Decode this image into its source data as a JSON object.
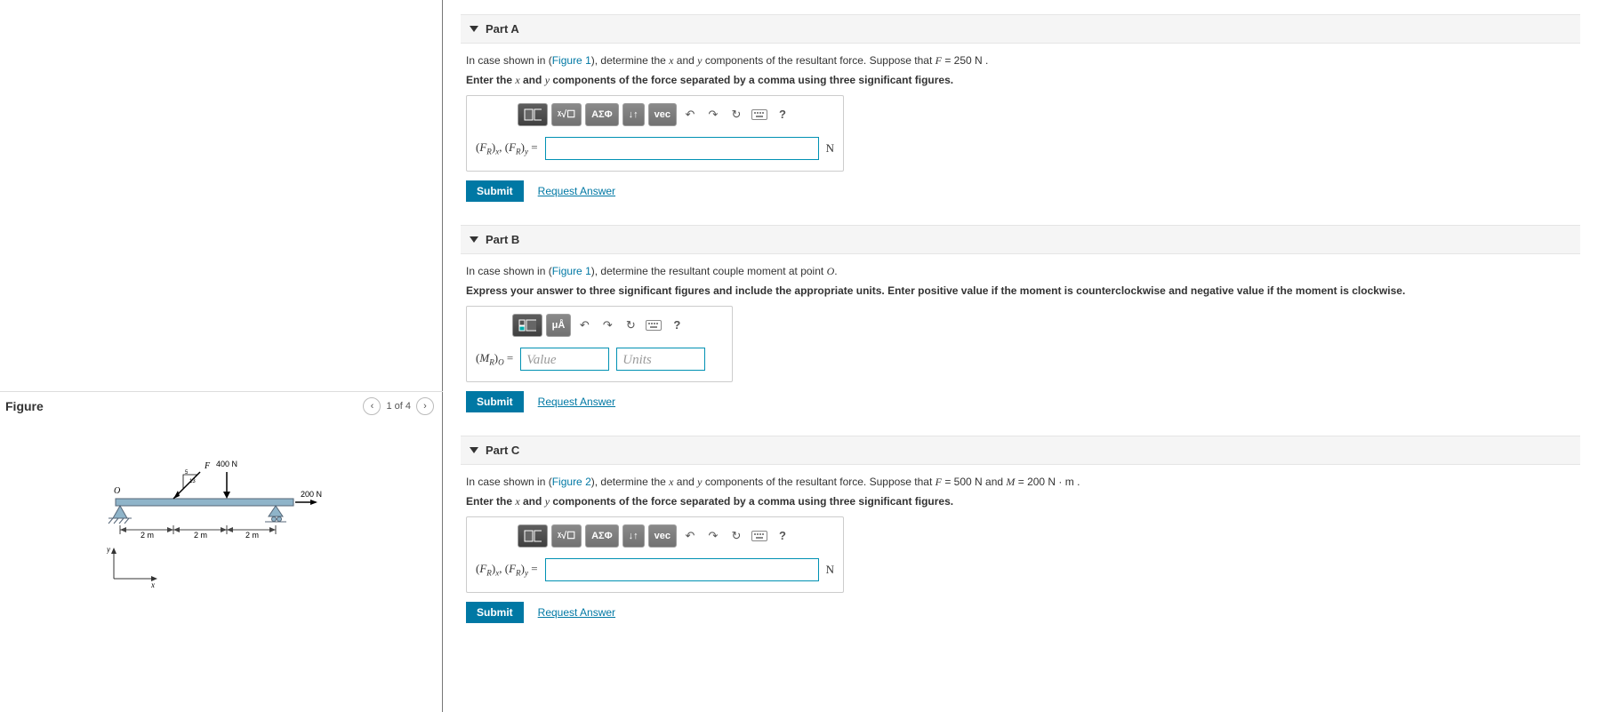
{
  "figure": {
    "title": "Figure",
    "pager": "1 of 4",
    "labels": {
      "F": "F",
      "force400": "400 N",
      "force200": "200 N",
      "d1": "2 m",
      "d2": "2 m",
      "d3": "2 m",
      "axisY": "y",
      "axisX": "x",
      "O": "O",
      "angle": "5",
      "angle2": "13"
    }
  },
  "partA": {
    "title": "Part A",
    "text1a": "In case shown in (",
    "figLink": "Figure 1",
    "text1b": "), determine the ",
    "var_x": "x",
    "text1c": " and ",
    "var_y": "y",
    "text1d": " components of the resultant force. Suppose that ",
    "var_F": "F",
    "text1e": " = 250  N .",
    "instr1": "Enter the ",
    "instr2": " and ",
    "instr3": " components of the force separated by a comma using three significant figures.",
    "tool_sqrt": "ᵡ√☐",
    "tool_greek": "ΑΣΦ",
    "tool_arrows": "↓↑",
    "tool_vec": "vec",
    "tool_undo": "↶",
    "tool_redo": "↷",
    "tool_reset": "↻",
    "tool_help": "?",
    "lhs_a": "(",
    "lhs_b": "F",
    "lhs_c": "R",
    "lhs_d": ")",
    "lhs_e": "x",
    "lhs_f": ", (",
    "lhs_g": "y",
    "lhs_h": " = ",
    "unit": "N",
    "submit": "Submit",
    "request": "Request Answer"
  },
  "partB": {
    "title": "Part B",
    "text1a": "In case shown in (",
    "figLink": "Figure 1",
    "text1b": "), determine the resultant couple moment at point ",
    "var_O": "O",
    "text1c": ".",
    "instr": "Express your answer to three significant figures and include the appropriate units. Enter positive value if the moment is counterclockwise and negative value if the moment is clockwise.",
    "tool_frac": "▫/▫",
    "tool_mu": "μÅ",
    "tool_undo": "↶",
    "tool_redo": "↷",
    "tool_reset": "↻",
    "tool_help": "?",
    "lhs_a": "(",
    "lhs_b": "M",
    "lhs_c": "R",
    "lhs_d": ")",
    "lhs_e": "O",
    "lhs_h": " = ",
    "ph_value": "Value",
    "ph_units": "Units",
    "submit": "Submit",
    "request": "Request Answer"
  },
  "partC": {
    "title": "Part C",
    "text1a": "In case shown in (",
    "figLink": "Figure 2",
    "text1b": "), determine the ",
    "var_x": "x",
    "text1c": " and ",
    "var_y": "y",
    "text1d": " components of the resultant force. Suppose that ",
    "var_F": "F",
    "text1e": " = 500  N and ",
    "var_M": "M",
    "text1f": " = 200  N · m .",
    "instr1": "Enter the ",
    "instr2": " and ",
    "instr3": " components of the force separated by a comma using three significant figures.",
    "unit": "N",
    "submit": "Submit",
    "request": "Request Answer"
  }
}
